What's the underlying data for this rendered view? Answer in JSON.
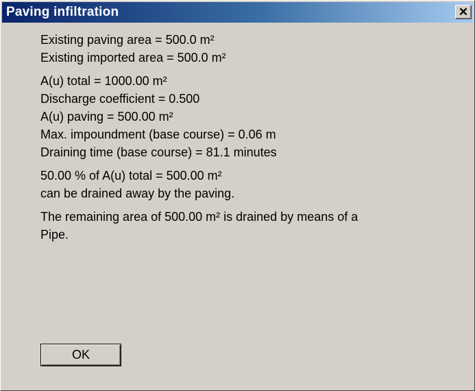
{
  "window": {
    "title": "Paving infiltration",
    "close_glyph": "✕"
  },
  "areas": {
    "existing_paving": "Existing paving area = 500.0 m²",
    "existing_imported": "Existing imported area = 500.0 m²"
  },
  "results": {
    "au_total": "A(u) total = 1000.00 m²",
    "discharge_coefficient": "Discharge coefficient = 0.500",
    "au_paving": "A(u) paving = 500.00 m²",
    "max_impoundment": "Max. impoundment (base course) = 0.06 m",
    "draining_time": "Draining time (base course) = 81.1 minutes"
  },
  "drainage": {
    "line1": "50.00 % of A(u) total = 500.00 m²",
    "line2": "can be drained away by the paving."
  },
  "remaining": {
    "line1": "The remaining area of 500.00 m² is drained by means of a",
    "line2": "Pipe."
  },
  "buttons": {
    "ok_label": "OK"
  }
}
